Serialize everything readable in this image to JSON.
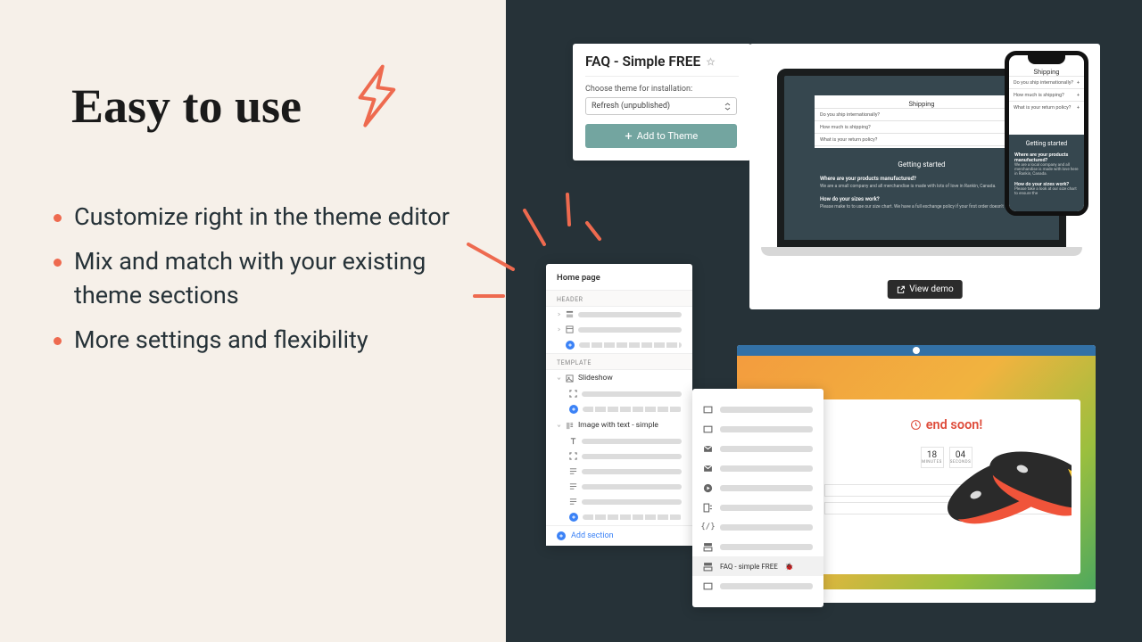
{
  "heading": "Easy to use",
  "bullets": [
    "Customize right in the theme editor",
    "Mix and match with your existing theme sections",
    "More settings and flexibility"
  ],
  "install": {
    "title": "FAQ - Simple FREE",
    "choose_label": "Choose theme for installation:",
    "selected": "Refresh (unpublished)",
    "button": "Add to Theme"
  },
  "demo": {
    "laptop": {
      "cat": "Shipping",
      "q1": "Do you ship internationally?",
      "q2": "How much is shipping?",
      "q3": "What is your return policy?",
      "gs_title": "Getting started",
      "gs_q1": "Where are your products manufactured?",
      "gs_a1": "We are a small company and all merchandise is made with lots of love in Rankin, Canada.",
      "gs_q2": "How do your sizes work?",
      "gs_a2": "Please make to to use our size chart. We have a full exchange policy if your first order doesn't fit."
    },
    "phone": {
      "cat": "Shipping",
      "q1": "Do you ship internationally?",
      "q2": "How much is shipping?",
      "q3": "What is your return policy?",
      "gs_title": "Getting started",
      "gs_q1": "Where are your products manufactured?",
      "gs_a1": "We are a local company and all merchandise is made with love here in Rankin, Canada.",
      "gs_q2": "How do your sizes work?",
      "gs_a2": "Please take a look at our size chart to ensure the"
    },
    "view_demo": "View demo"
  },
  "editor": {
    "page_title": "Home page",
    "cat_header": "HEADER",
    "cat_template": "TEMPLATE",
    "slideshow": "Slideshow",
    "image_text": "Image with text - simple",
    "add_section": "Add section"
  },
  "picker": {
    "selected_label": "FAQ - simple FREE"
  },
  "promo": {
    "title": "end soon!",
    "timer": [
      {
        "n": "18",
        "l": "MINUTES"
      },
      {
        "n": "04",
        "l": "SECONDS"
      }
    ]
  },
  "colors": {
    "accent": "#ee6a4f",
    "teal": "#73a5a0",
    "dark": "#263238"
  }
}
